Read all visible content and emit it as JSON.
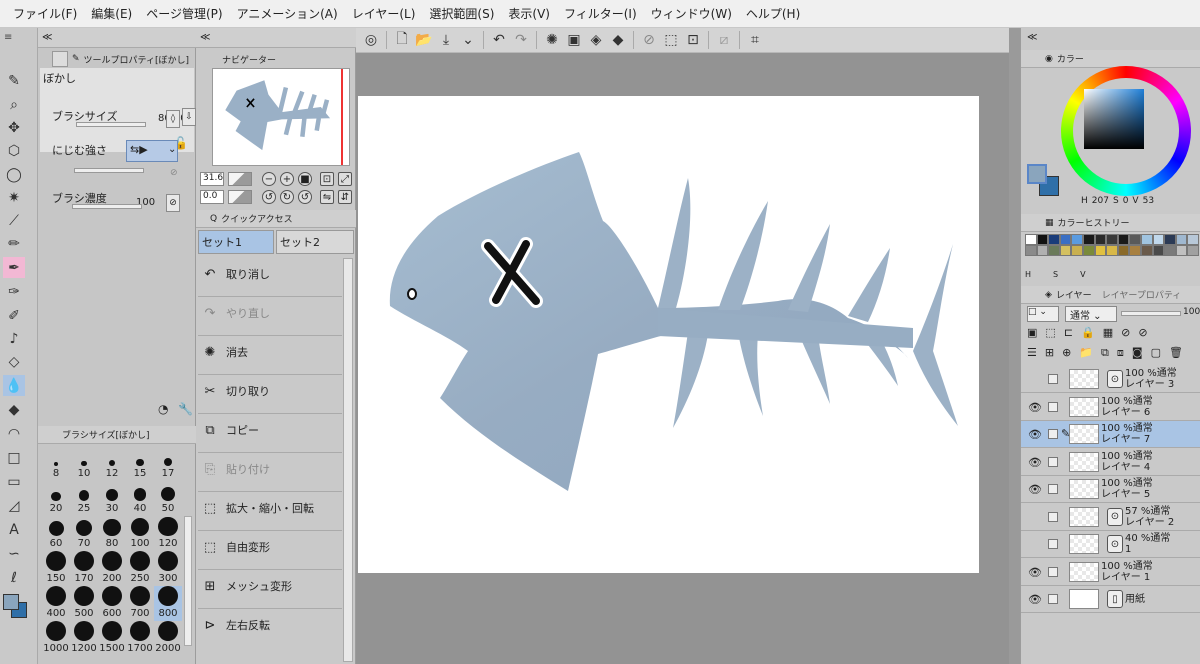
{
  "menu": [
    "ファイル(F)",
    "編集(E)",
    "ページ管理(P)",
    "アニメーション(A)",
    "レイヤー(L)",
    "選択範囲(S)",
    "表示(V)",
    "フィルター(I)",
    "ウィンドウ(W)",
    "ヘルプ(H)"
  ],
  "tool_property": {
    "tab_title": "ツールプロパティ[ぼかし]",
    "tool_name": "ぼかし",
    "brush_size_label": "ブラシサイズ",
    "brush_size_value": "800.0",
    "blur_strength_label": "にじむ強さ",
    "brush_density_label": "ブラシ濃度",
    "brush_density_value": "100"
  },
  "brush_size_panel": {
    "tab_title": "ブラシサイズ[ぼかし]",
    "sizes": [
      "8",
      "10",
      "12",
      "15",
      "17",
      "20",
      "25",
      "30",
      "40",
      "50",
      "60",
      "70",
      "80",
      "100",
      "120",
      "150",
      "170",
      "200",
      "250",
      "300",
      "400",
      "500",
      "600",
      "700",
      "800",
      "1000",
      "1200",
      "1500",
      "1700",
      "2000"
    ],
    "selected": "800"
  },
  "navigator": {
    "tab_title": "ナビゲーター",
    "zoom": "31.6",
    "rotation": "0.0"
  },
  "quick_access": {
    "tab_title": "クイックアクセス",
    "sets": [
      "セット1",
      "セット2"
    ],
    "items": [
      {
        "label": "取り消し",
        "icon": "undo-icon",
        "disabled": false
      },
      {
        "label": "やり直し",
        "icon": "redo-icon",
        "disabled": true
      },
      {
        "label": "消去",
        "icon": "clear-icon",
        "disabled": false
      },
      {
        "label": "切り取り",
        "icon": "scissors-icon",
        "disabled": false
      },
      {
        "label": "コピー",
        "icon": "copy-icon",
        "disabled": false
      },
      {
        "label": "貼り付け",
        "icon": "paste-icon",
        "disabled": true
      },
      {
        "label": "拡大・縮小・回転",
        "icon": "transform-icon",
        "disabled": false
      },
      {
        "label": "自由変形",
        "icon": "free-transform-icon",
        "disabled": false
      },
      {
        "label": "メッシュ変形",
        "icon": "mesh-transform-icon",
        "disabled": false
      },
      {
        "label": "左右反転",
        "icon": "flip-horizontal-icon",
        "disabled": false
      }
    ]
  },
  "color_panel": {
    "tab_title": "カラー",
    "h": "207",
    "s": "0",
    "v": "53",
    "h_label": "H",
    "s_label": "S",
    "v_label": "V",
    "main_color": "#8aa5bd",
    "sub_color": "#2f6fa8"
  },
  "color_history": {
    "tab_title": "カラーヒストリー",
    "colors": [
      "#ffffff",
      "#111111",
      "#1a3c7a",
      "#3a6fc4",
      "#5a9be0",
      "#1a1a1a",
      "#2a2a2a",
      "#3a3a3a",
      "#1a1a1a",
      "#5a5a5a",
      "#a0c4e0",
      "#c0d8ec",
      "#2b3a55",
      "#9fb8d0",
      "#b8c8d8",
      "#8a8a8a",
      "#b0b0b0",
      "#6a7a5a",
      "#d4c060",
      "#c9b050",
      "#7a8a3a",
      "#e0c040",
      "#d8b848",
      "#8a6a2a",
      "#a88040",
      "#6a5a4a",
      "#4a4a4a",
      "#7a7a7a",
      "#c0c0c0",
      "#a0a0a0"
    ]
  },
  "layer_panel": {
    "tab_title": "レイヤー",
    "tab2_title": "レイヤープロパティ",
    "blend_mode": "通常",
    "opacity": "100",
    "layers": [
      {
        "opacity": "100 %",
        "mode": "通常",
        "name": "レイヤー 3",
        "visible": false,
        "selected": false,
        "icon": true
      },
      {
        "opacity": "100 %",
        "mode": "通常",
        "name": "レイヤー 6",
        "visible": true,
        "selected": false,
        "icon": false
      },
      {
        "opacity": "100 %",
        "mode": "通常",
        "name": "レイヤー 7",
        "visible": true,
        "selected": true,
        "icon": false
      },
      {
        "opacity": "100 %",
        "mode": "通常",
        "name": "レイヤー 4",
        "visible": true,
        "selected": false,
        "icon": false
      },
      {
        "opacity": "100 %",
        "mode": "通常",
        "name": "レイヤー 5",
        "visible": true,
        "selected": false,
        "icon": false
      },
      {
        "opacity": "57 %",
        "mode": "通常",
        "name": "レイヤー 2",
        "visible": false,
        "selected": false,
        "icon": true
      },
      {
        "opacity": "40 %",
        "mode": "通常",
        "name": "1",
        "visible": false,
        "selected": false,
        "icon": true
      },
      {
        "opacity": "100 %",
        "mode": "通常",
        "name": "レイヤー 1",
        "visible": true,
        "selected": false,
        "icon": false
      },
      {
        "opacity": "",
        "mode": "",
        "name": "用紙",
        "visible": true,
        "selected": false,
        "icon": true
      }
    ]
  }
}
